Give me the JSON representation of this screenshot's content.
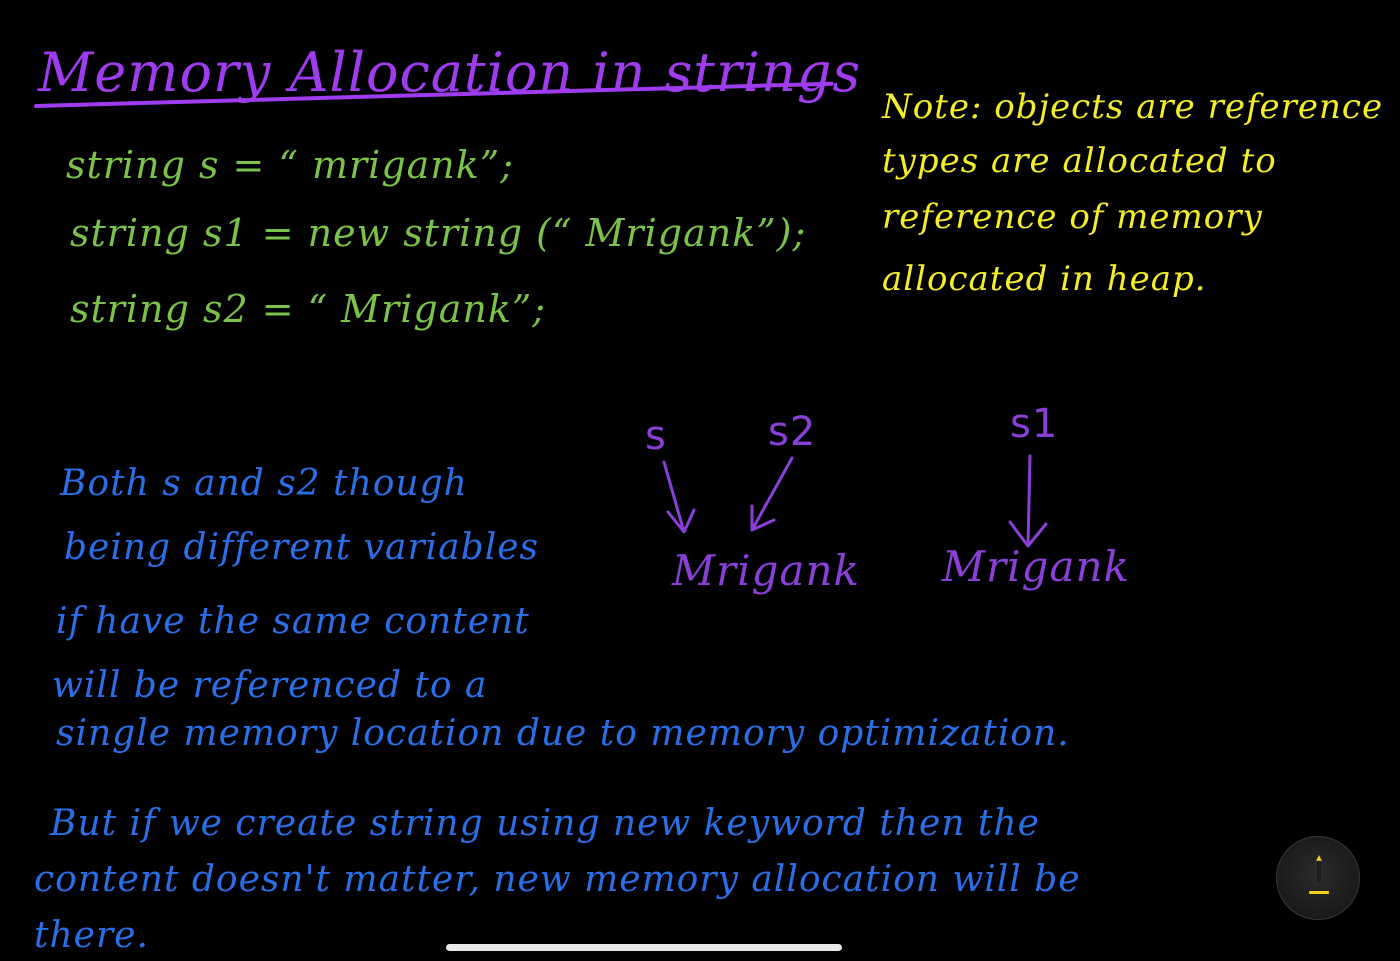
{
  "title": "Memory Allocation in strings",
  "code": {
    "line1": "string s = “ mrigank”;",
    "line2": "string s1 = new string (“ Mrigank”);",
    "line3": "string s2 = “ Mrigank”;"
  },
  "note": {
    "line1": "Note: objects are reference",
    "line2": "types are allocated to",
    "line3": "reference of memory",
    "line4": "allocated in heap."
  },
  "diagram": {
    "var_s": "s",
    "var_s2": "s2",
    "var_s1": "s1",
    "value_left": "Mrigank",
    "value_right": "Mrigank"
  },
  "explanation": {
    "line1": "Both s and s2 though",
    "line2": "being different variables",
    "line3": "if have the same content",
    "line4": "will be referenced to a",
    "line5": "single memory location due to memory optimization.",
    "line6": "But if we create string using new keyword then the",
    "line7": "content doesn't matter, new memory allocation will be",
    "line8": "there."
  },
  "colors": {
    "title": "#a03cf0",
    "code": "#7bc24a",
    "note": "#f4ee2a",
    "diagram": "#8a3fd8",
    "explanation": "#2a6fe8",
    "background": "#000000"
  },
  "icons": {
    "tool": "pencil-icon"
  }
}
